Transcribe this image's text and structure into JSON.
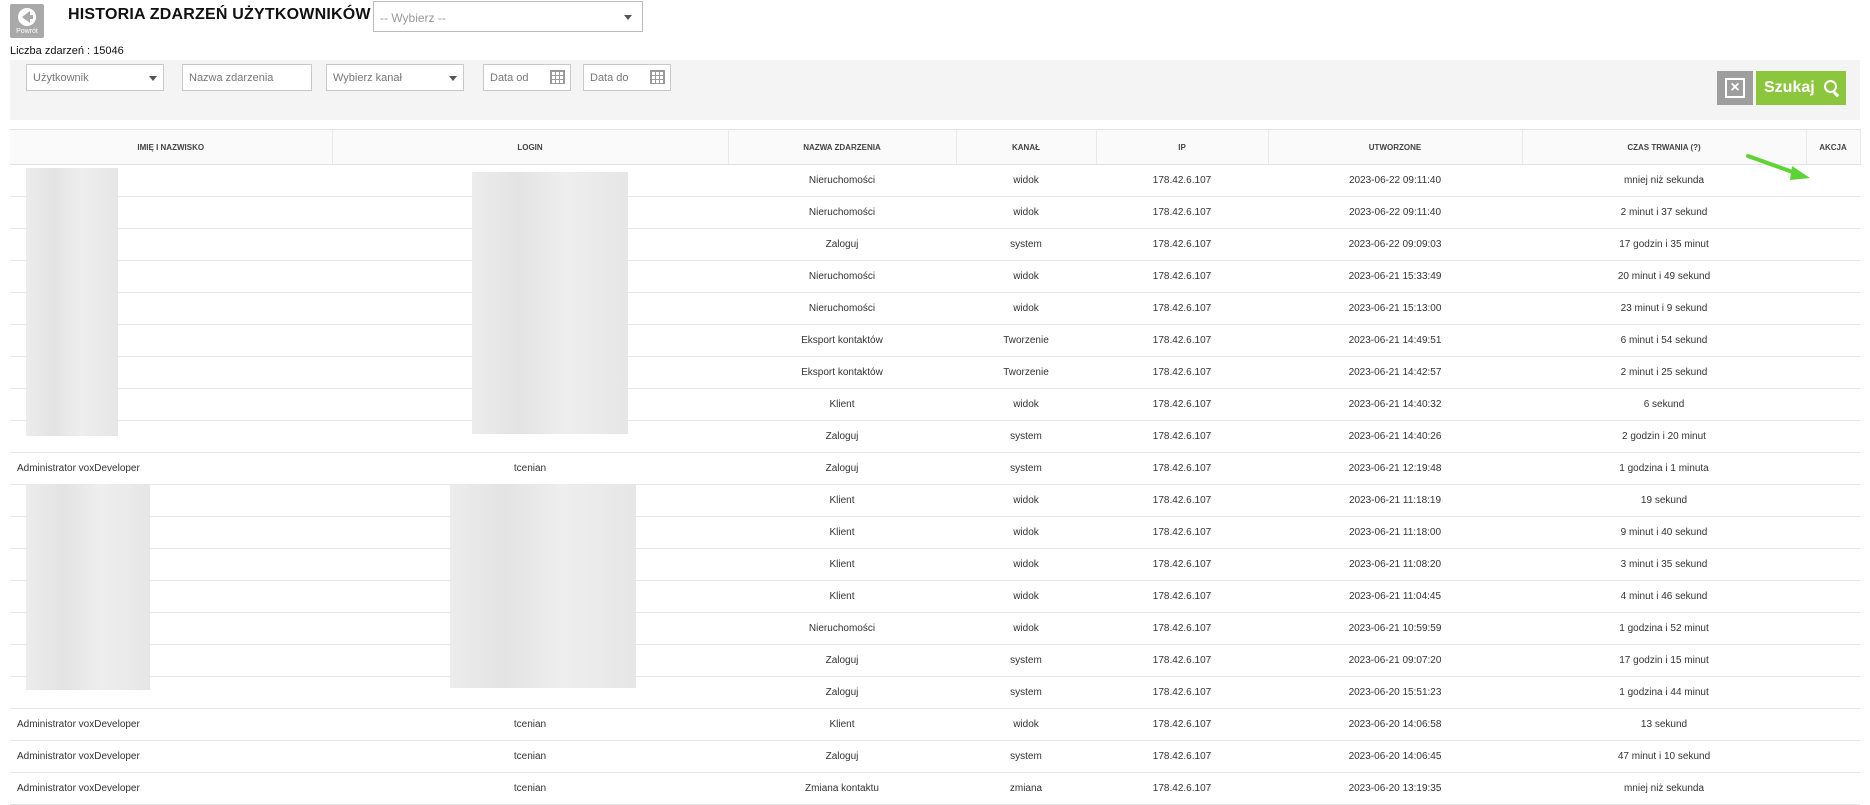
{
  "header": {
    "back_label": "Powrót",
    "title": "HISTORIA ZDARZEŃ UŻYTKOWNIKÓW",
    "select_placeholder": "-- Wybierz --"
  },
  "count_text": "Liczba zdarzeń : 15046",
  "filters": {
    "user_placeholder": "Użytkownik",
    "event_placeholder": "Nazwa zdarzenia",
    "channel_placeholder": "Wybierz kanał",
    "date_from": "Data od",
    "date_to": "Data do",
    "search_label": "Szukaj"
  },
  "table": {
    "headers": [
      "IMIĘ I NAZWISKO",
      "LOGIN",
      "NAZWA ZDARZENIA",
      "KANAŁ",
      "IP",
      "UTWORZONE",
      "CZAS TRWANIA (?)",
      "AKCJA"
    ],
    "rows": [
      {
        "name": "",
        "login": "",
        "event": "Nieruchomości",
        "channel": "widok",
        "ip": "178.42.6.107",
        "created": "2023-06-22 09:11:40",
        "duration": "mniej niż sekunda"
      },
      {
        "name": "",
        "login": "",
        "event": "Nieruchomości",
        "channel": "widok",
        "ip": "178.42.6.107",
        "created": "2023-06-22 09:11:40",
        "duration": "2 minut i 37 sekund"
      },
      {
        "name": "",
        "login": "",
        "event": "Zaloguj",
        "channel": "system",
        "ip": "178.42.6.107",
        "created": "2023-06-22 09:09:03",
        "duration": "17 godzin i 35 minut"
      },
      {
        "name": "",
        "login": "",
        "event": "Nieruchomości",
        "channel": "widok",
        "ip": "178.42.6.107",
        "created": "2023-06-21 15:33:49",
        "duration": "20 minut i 49 sekund"
      },
      {
        "name": "",
        "login": "",
        "event": "Nieruchomości",
        "channel": "widok",
        "ip": "178.42.6.107",
        "created": "2023-06-21 15:13:00",
        "duration": "23 minut i 9 sekund"
      },
      {
        "name": "",
        "login": "",
        "event": "Eksport kontaktów",
        "channel": "Tworzenie",
        "ip": "178.42.6.107",
        "created": "2023-06-21 14:49:51",
        "duration": "6 minut i 54 sekund"
      },
      {
        "name": "",
        "login": "",
        "event": "Eksport kontaktów",
        "channel": "Tworzenie",
        "ip": "178.42.6.107",
        "created": "2023-06-21 14:42:57",
        "duration": "2 minut i 25 sekund"
      },
      {
        "name": "",
        "login": "",
        "event": "Klient",
        "channel": "widok",
        "ip": "178.42.6.107",
        "created": "2023-06-21 14:40:32",
        "duration": "6 sekund"
      },
      {
        "name": "",
        "login": "",
        "event": "Zaloguj",
        "channel": "system",
        "ip": "178.42.6.107",
        "created": "2023-06-21 14:40:26",
        "duration": "2 godzin i 20 minut"
      },
      {
        "name": "Administrator voxDeveloper",
        "login": "tcenian",
        "event": "Zaloguj",
        "channel": "system",
        "ip": "178.42.6.107",
        "created": "2023-06-21 12:19:48",
        "duration": "1 godzina i 1 minuta"
      },
      {
        "name": "",
        "login": "",
        "event": "Klient",
        "channel": "widok",
        "ip": "178.42.6.107",
        "created": "2023-06-21 11:18:19",
        "duration": "19 sekund"
      },
      {
        "name": "",
        "login": "",
        "event": "Klient",
        "channel": "widok",
        "ip": "178.42.6.107",
        "created": "2023-06-21 11:18:00",
        "duration": "9 minut i 40 sekund"
      },
      {
        "name": "",
        "login": "",
        "event": "Klient",
        "channel": "widok",
        "ip": "178.42.6.107",
        "created": "2023-06-21 11:08:20",
        "duration": "3 minut i 35 sekund"
      },
      {
        "name": "",
        "login": "",
        "event": "Klient",
        "channel": "widok",
        "ip": "178.42.6.107",
        "created": "2023-06-21 11:04:45",
        "duration": "4 minut i 46 sekund"
      },
      {
        "name": "",
        "login": "",
        "event": "Nieruchomości",
        "channel": "widok",
        "ip": "178.42.6.107",
        "created": "2023-06-21 10:59:59",
        "duration": "1 godzina i 52 minut"
      },
      {
        "name": "",
        "login": "",
        "event": "Zaloguj",
        "channel": "system",
        "ip": "178.42.6.107",
        "created": "2023-06-21 09:07:20",
        "duration": "17 godzin i 15 minut"
      },
      {
        "name": "",
        "login": "",
        "event": "Zaloguj",
        "channel": "system",
        "ip": "178.42.6.107",
        "created": "2023-06-20 15:51:23",
        "duration": "1 godzina i 44 minut"
      },
      {
        "name": "Administrator voxDeveloper",
        "login": "tcenian",
        "event": "Klient",
        "channel": "widok",
        "ip": "178.42.6.107",
        "created": "2023-06-20 14:06:58",
        "duration": "13 sekund"
      },
      {
        "name": "Administrator voxDeveloper",
        "login": "tcenian",
        "event": "Zaloguj",
        "channel": "system",
        "ip": "178.42.6.107",
        "created": "2023-06-20 14:06:45",
        "duration": "47 minut i 10 sekund"
      },
      {
        "name": "Administrator voxDeveloper",
        "login": "tcenian",
        "event": "Zmiana kontaktu",
        "channel": "zmiana",
        "ip": "178.42.6.107",
        "created": "2023-06-20 13:19:35",
        "duration": "mniej niż sekunda"
      }
    ]
  },
  "colors": {
    "search_button": "#8cc63f",
    "clear_button": "#9e9e9e",
    "annotation_arrow": "#5ed335"
  }
}
